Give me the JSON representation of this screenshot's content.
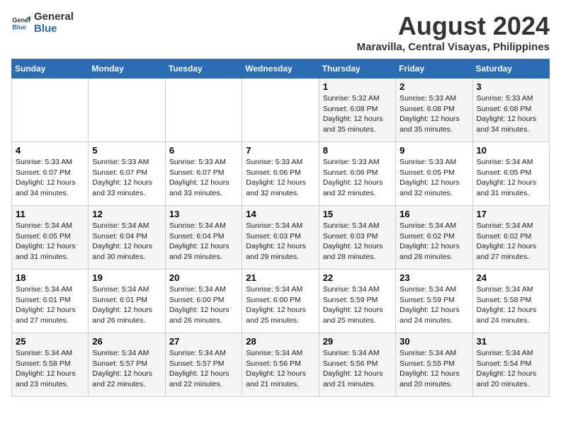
{
  "header": {
    "logo_general": "General",
    "logo_blue": "Blue",
    "title": "August 2024",
    "subtitle": "Maravilla, Central Visayas, Philippines"
  },
  "weekdays": [
    "Sunday",
    "Monday",
    "Tuesday",
    "Wednesday",
    "Thursday",
    "Friday",
    "Saturday"
  ],
  "weeks": [
    [
      {
        "day": "",
        "sunrise": "",
        "sunset": "",
        "daylight": ""
      },
      {
        "day": "",
        "sunrise": "",
        "sunset": "",
        "daylight": ""
      },
      {
        "day": "",
        "sunrise": "",
        "sunset": "",
        "daylight": ""
      },
      {
        "day": "",
        "sunrise": "",
        "sunset": "",
        "daylight": ""
      },
      {
        "day": "1",
        "sunrise": "Sunrise: 5:32 AM",
        "sunset": "Sunset: 6:08 PM",
        "daylight": "Daylight: 12 hours and 35 minutes."
      },
      {
        "day": "2",
        "sunrise": "Sunrise: 5:33 AM",
        "sunset": "Sunset: 6:08 PM",
        "daylight": "Daylight: 12 hours and 35 minutes."
      },
      {
        "day": "3",
        "sunrise": "Sunrise: 5:33 AM",
        "sunset": "Sunset: 6:08 PM",
        "daylight": "Daylight: 12 hours and 34 minutes."
      }
    ],
    [
      {
        "day": "4",
        "sunrise": "Sunrise: 5:33 AM",
        "sunset": "Sunset: 6:07 PM",
        "daylight": "Daylight: 12 hours and 34 minutes."
      },
      {
        "day": "5",
        "sunrise": "Sunrise: 5:33 AM",
        "sunset": "Sunset: 6:07 PM",
        "daylight": "Daylight: 12 hours and 33 minutes."
      },
      {
        "day": "6",
        "sunrise": "Sunrise: 5:33 AM",
        "sunset": "Sunset: 6:07 PM",
        "daylight": "Daylight: 12 hours and 33 minutes."
      },
      {
        "day": "7",
        "sunrise": "Sunrise: 5:33 AM",
        "sunset": "Sunset: 6:06 PM",
        "daylight": "Daylight: 12 hours and 32 minutes."
      },
      {
        "day": "8",
        "sunrise": "Sunrise: 5:33 AM",
        "sunset": "Sunset: 6:06 PM",
        "daylight": "Daylight: 12 hours and 32 minutes."
      },
      {
        "day": "9",
        "sunrise": "Sunrise: 5:33 AM",
        "sunset": "Sunset: 6:05 PM",
        "daylight": "Daylight: 12 hours and 32 minutes."
      },
      {
        "day": "10",
        "sunrise": "Sunrise: 5:34 AM",
        "sunset": "Sunset: 6:05 PM",
        "daylight": "Daylight: 12 hours and 31 minutes."
      }
    ],
    [
      {
        "day": "11",
        "sunrise": "Sunrise: 5:34 AM",
        "sunset": "Sunset: 6:05 PM",
        "daylight": "Daylight: 12 hours and 31 minutes."
      },
      {
        "day": "12",
        "sunrise": "Sunrise: 5:34 AM",
        "sunset": "Sunset: 6:04 PM",
        "daylight": "Daylight: 12 hours and 30 minutes."
      },
      {
        "day": "13",
        "sunrise": "Sunrise: 5:34 AM",
        "sunset": "Sunset: 6:04 PM",
        "daylight": "Daylight: 12 hours and 29 minutes."
      },
      {
        "day": "14",
        "sunrise": "Sunrise: 5:34 AM",
        "sunset": "Sunset: 6:03 PM",
        "daylight": "Daylight: 12 hours and 29 minutes."
      },
      {
        "day": "15",
        "sunrise": "Sunrise: 5:34 AM",
        "sunset": "Sunset: 6:03 PM",
        "daylight": "Daylight: 12 hours and 28 minutes."
      },
      {
        "day": "16",
        "sunrise": "Sunrise: 5:34 AM",
        "sunset": "Sunset: 6:02 PM",
        "daylight": "Daylight: 12 hours and 28 minutes."
      },
      {
        "day": "17",
        "sunrise": "Sunrise: 5:34 AM",
        "sunset": "Sunset: 6:02 PM",
        "daylight": "Daylight: 12 hours and 27 minutes."
      }
    ],
    [
      {
        "day": "18",
        "sunrise": "Sunrise: 5:34 AM",
        "sunset": "Sunset: 6:01 PM",
        "daylight": "Daylight: 12 hours and 27 minutes."
      },
      {
        "day": "19",
        "sunrise": "Sunrise: 5:34 AM",
        "sunset": "Sunset: 6:01 PM",
        "daylight": "Daylight: 12 hours and 26 minutes."
      },
      {
        "day": "20",
        "sunrise": "Sunrise: 5:34 AM",
        "sunset": "Sunset: 6:00 PM",
        "daylight": "Daylight: 12 hours and 26 minutes."
      },
      {
        "day": "21",
        "sunrise": "Sunrise: 5:34 AM",
        "sunset": "Sunset: 6:00 PM",
        "daylight": "Daylight: 12 hours and 25 minutes."
      },
      {
        "day": "22",
        "sunrise": "Sunrise: 5:34 AM",
        "sunset": "Sunset: 5:59 PM",
        "daylight": "Daylight: 12 hours and 25 minutes."
      },
      {
        "day": "23",
        "sunrise": "Sunrise: 5:34 AM",
        "sunset": "Sunset: 5:59 PM",
        "daylight": "Daylight: 12 hours and 24 minutes."
      },
      {
        "day": "24",
        "sunrise": "Sunrise: 5:34 AM",
        "sunset": "Sunset: 5:58 PM",
        "daylight": "Daylight: 12 hours and 24 minutes."
      }
    ],
    [
      {
        "day": "25",
        "sunrise": "Sunrise: 5:34 AM",
        "sunset": "Sunset: 5:58 PM",
        "daylight": "Daylight: 12 hours and 23 minutes."
      },
      {
        "day": "26",
        "sunrise": "Sunrise: 5:34 AM",
        "sunset": "Sunset: 5:57 PM",
        "daylight": "Daylight: 12 hours and 22 minutes."
      },
      {
        "day": "27",
        "sunrise": "Sunrise: 5:34 AM",
        "sunset": "Sunset: 5:57 PM",
        "daylight": "Daylight: 12 hours and 22 minutes."
      },
      {
        "day": "28",
        "sunrise": "Sunrise: 5:34 AM",
        "sunset": "Sunset: 5:56 PM",
        "daylight": "Daylight: 12 hours and 21 minutes."
      },
      {
        "day": "29",
        "sunrise": "Sunrise: 5:34 AM",
        "sunset": "Sunset: 5:56 PM",
        "daylight": "Daylight: 12 hours and 21 minutes."
      },
      {
        "day": "30",
        "sunrise": "Sunrise: 5:34 AM",
        "sunset": "Sunset: 5:55 PM",
        "daylight": "Daylight: 12 hours and 20 minutes."
      },
      {
        "day": "31",
        "sunrise": "Sunrise: 5:34 AM",
        "sunset": "Sunset: 5:54 PM",
        "daylight": "Daylight: 12 hours and 20 minutes."
      }
    ]
  ]
}
